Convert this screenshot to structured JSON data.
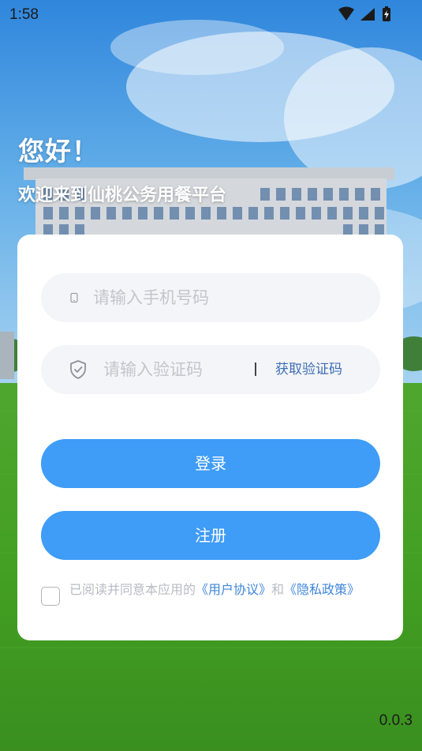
{
  "status_bar": {
    "time": "1:58"
  },
  "header": {
    "greeting": "您好！",
    "welcome": "欢迎来到仙桃公务用餐平台"
  },
  "form": {
    "phone": {
      "placeholder": "请输入手机号码",
      "icon": "phone-icon"
    },
    "code": {
      "placeholder": "请输入验证码",
      "icon": "shield-icon",
      "get_code_label": "获取验证码"
    },
    "login_label": "登录",
    "register_label": "注册",
    "agreement": {
      "checked": false,
      "prefix": "已阅读并同意本应用的",
      "user_agreement": "《用户协议》",
      "and": "和",
      "privacy_policy": "《隐私政策》"
    }
  },
  "version": "0.0.3",
  "colors": {
    "primary_button": "#3f9cf7",
    "link": "#3f86d9",
    "get_code": "#3d6fb3",
    "input_bg": "#f4f5f9",
    "placeholder": "#c3c5cc"
  }
}
